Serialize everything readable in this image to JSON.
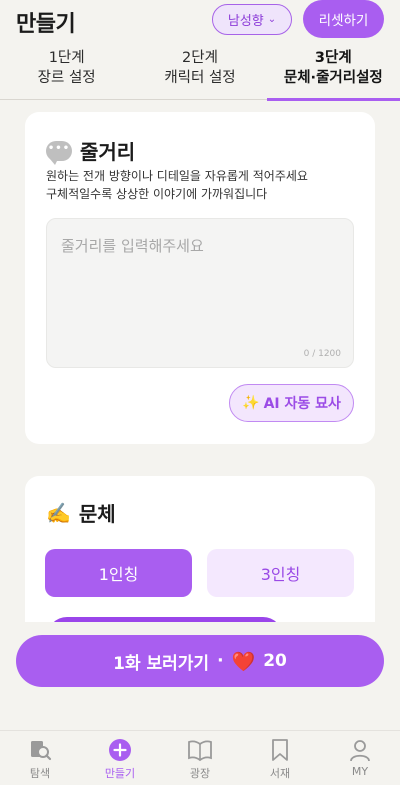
{
  "header": {
    "title": "만들기",
    "gender_select": "남성향",
    "reset_label": "리셋하기"
  },
  "steps": [
    {
      "step": "1단계",
      "label": "장르 설정"
    },
    {
      "step": "2단계",
      "label": "캐릭터 설정"
    },
    {
      "step": "3단계",
      "label": "문체·줄거리설정"
    }
  ],
  "active_step": 3,
  "plot": {
    "title": "줄거리",
    "help_line1": "원하는 전개 방향이나 디테일을 자유롭게 적어주세요",
    "help_line2": "구체적일수록 상상한 이야기에 가까워집니다",
    "placeholder": "줄거리를 입력해주세요",
    "char_count": "0 / 1200",
    "ai_button": "AI 자동 묘사"
  },
  "style": {
    "title": "문체",
    "options": [
      "1인칭",
      "3인칭"
    ],
    "selected": "1인칭"
  },
  "cta": {
    "label": "1화 보러가기",
    "separator": "·",
    "hearts": "20"
  },
  "nav": [
    {
      "label": "탐색",
      "icon": "search-book-icon"
    },
    {
      "label": "만들기",
      "icon": "plus-circle-icon"
    },
    {
      "label": "광장",
      "icon": "open-book-icon"
    },
    {
      "label": "서재",
      "icon": "bookmark-icon"
    },
    {
      "label": "MY",
      "icon": "person-icon"
    }
  ],
  "active_nav": "만들기",
  "colors": {
    "accent": "#a95ef0",
    "accent_light": "#f4e8fe",
    "heart": "#f0364f"
  }
}
